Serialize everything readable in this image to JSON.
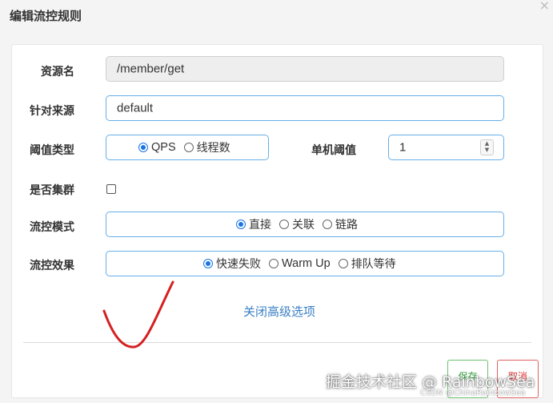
{
  "dialog": {
    "title": "编辑流控规则",
    "close_glyph": "×"
  },
  "form": {
    "resource": {
      "label": "资源名",
      "value": "/member/get"
    },
    "limit_app": {
      "label": "针对来源",
      "value": "default"
    },
    "threshold_type": {
      "label": "阈值类型",
      "options": [
        {
          "label": "QPS",
          "checked": true
        },
        {
          "label": "线程数",
          "checked": false
        }
      ]
    },
    "single_threshold": {
      "label": "单机阈值",
      "value": "1"
    },
    "cluster": {
      "label": "是否集群",
      "checked": false
    },
    "flow_mode": {
      "label": "流控模式",
      "options": [
        {
          "label": "直接",
          "checked": true
        },
        {
          "label": "关联",
          "checked": false
        },
        {
          "label": "链路",
          "checked": false
        }
      ]
    },
    "flow_effect": {
      "label": "流控效果",
      "options": [
        {
          "label": "快速失败",
          "checked": true
        },
        {
          "label": "Warm Up",
          "checked": false
        },
        {
          "label": "排队等待",
          "checked": false
        }
      ]
    },
    "advanced_link": "关闭高级选项"
  },
  "buttons": {
    "save": "保存",
    "cancel": "取消"
  },
  "watermark": {
    "main": "掘金技术社区 @ RainbowSea",
    "sub": "CSDN @ChinaRainbowSea"
  },
  "colors": {
    "accent": "#1a73e8",
    "link": "#3b7fc4",
    "save": "#2e9a3a",
    "cancel": "#d33333",
    "annotation": "#d42020"
  },
  "icons": {
    "close": "close-icon",
    "spinner": "spinner-arrows-icon",
    "annotation": "red-checkmark-annotation"
  }
}
